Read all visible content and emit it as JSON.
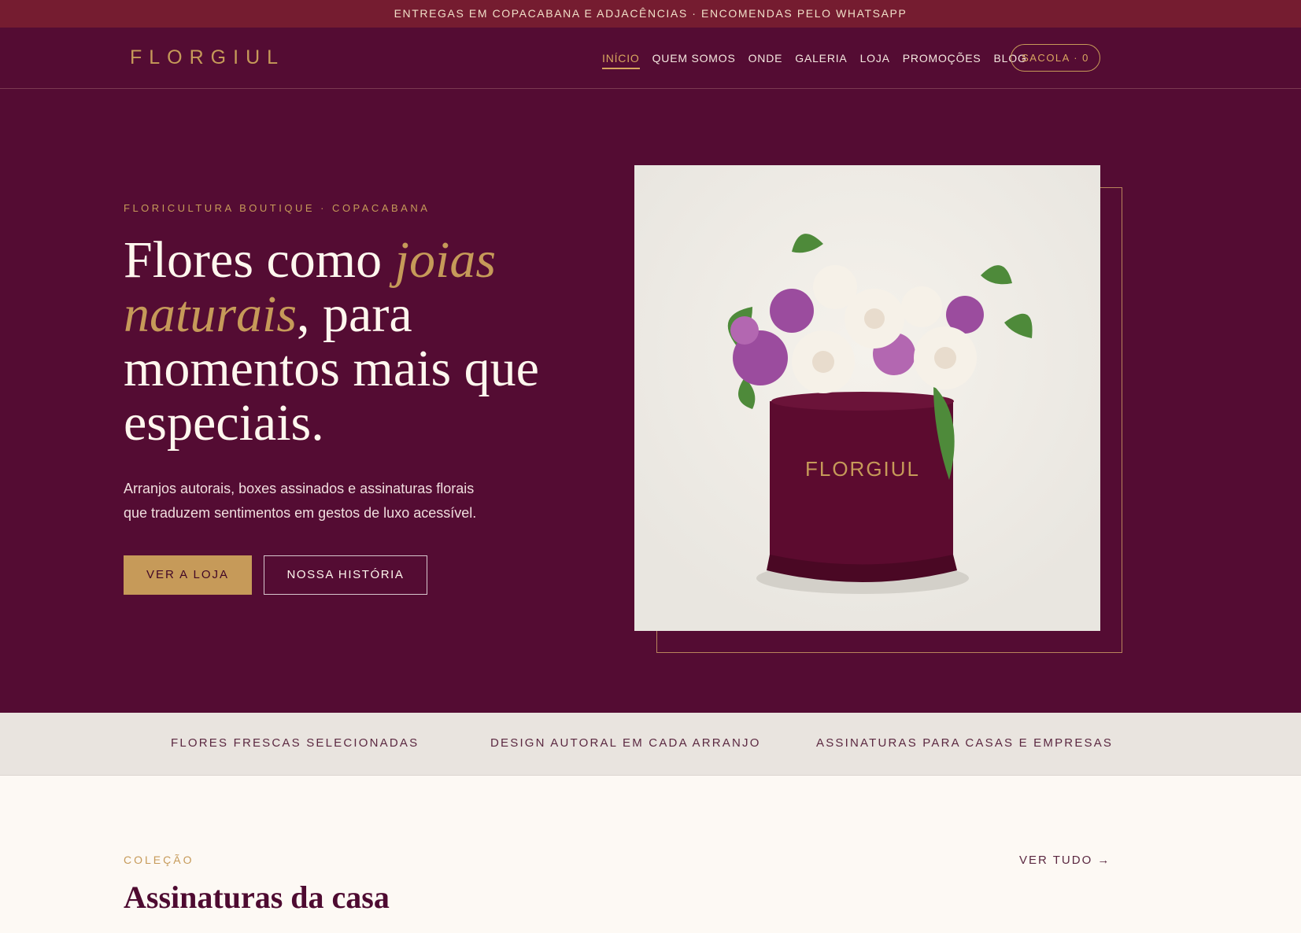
{
  "topbar": {
    "text": "ENTREGAS EM COPACABANA E ADJACÊNCIAS · ENCOMENDAS PELO WHATSAPP"
  },
  "nav": {
    "logo": "FLORGIUL",
    "items": [
      "INÍCIO",
      "QUEM SOMOS",
      "ONDE",
      "GALERIA",
      "LOJA",
      "PROMOÇÕES",
      "BLOG"
    ],
    "bag_label": "SACOLA · 0"
  },
  "hero": {
    "eyebrow": "FLORICULTURA BOUTIQUE · COPACABANA",
    "headline_part1": "Flores como ",
    "headline_em": "joias naturais",
    "headline_part2": ", para momentos mais que especiais.",
    "lede": "Arranjos autorais, boxes assinados e assinaturas florais que traduzem sentimentos em gestos de luxo acessível.",
    "primary_cta": "VER A LOJA",
    "secondary_cta": "NOSSA HISTÓRIA",
    "box_brand": "FLORGIUL"
  },
  "features": [
    "FLORES FRESCAS SELECIONADAS",
    "DESIGN AUTORAL EM CADA ARRANJO",
    "ASSINATURAS PARA CASAS E EMPRESAS"
  ],
  "collection": {
    "eyebrow": "COLEÇÃO",
    "title": "Assinaturas da casa",
    "see_all": "VER TUDO →"
  },
  "colors": {
    "accent": "#c69a59",
    "brand": "#540c33",
    "topbar": "#751c30"
  }
}
